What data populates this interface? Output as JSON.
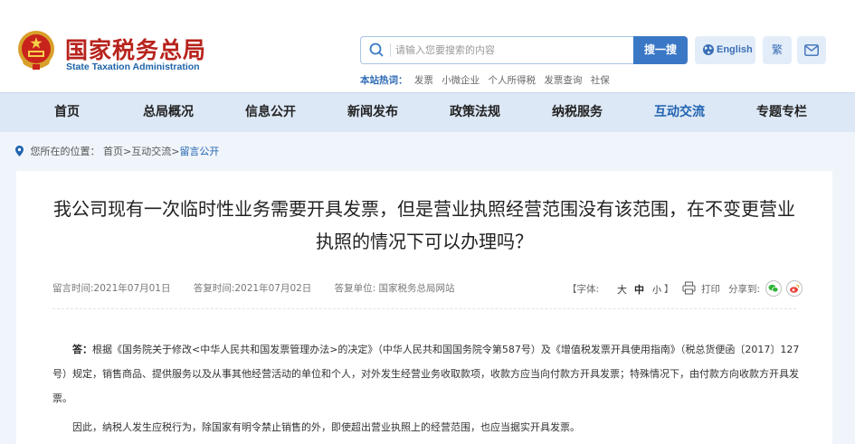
{
  "header": {
    "site_name_cn": "国家税务总局",
    "site_name_en": "State Taxation Administration",
    "search_placeholder": "请输入您要搜索的内容",
    "search_button": "搜一搜",
    "lang_english": "English",
    "lang_traditional": "繁",
    "hot_label": "本站热词：",
    "hot_words": [
      "发票",
      "小微企业",
      "个人所得税",
      "发票查询",
      "社保"
    ]
  },
  "nav": {
    "items": [
      "首页",
      "总局概况",
      "信息公开",
      "新闻发布",
      "政策法规",
      "纳税服务",
      "互动交流",
      "专题专栏"
    ],
    "active_index": 6
  },
  "breadcrumb": {
    "prefix": "您所在的位置：",
    "home": "首页",
    "sep1": ">",
    "level1": "互动交流",
    "sep2": ">",
    "current": "留言公开"
  },
  "article": {
    "title": "我公司现有一次临时性业务需要开具发票，但是营业执照经营范围没有该范围，在不变更营业执照的情况下可以办理吗？",
    "leave_time": "留言时间:2021年07月01日",
    "reply_time": "答复时间:2021年07月02日",
    "reply_unit": "答复单位:  国家税务总局网站",
    "font_label": "【字体:",
    "font_big": "大",
    "font_mid": "中",
    "font_small": "小",
    "font_close": "】",
    "print_label": "打印",
    "share_label": "分享到:",
    "answer_label": "答：",
    "answer_p1": "根据《国务院关于修改<中华人民共和国发票管理办法>的决定》（中华人民共和国国务院令第587号）及《增值税发票开具使用指南》（税总货便函〔2017〕127号）规定，销售商品、提供服务以及从事其他经营活动的单位和个人，对外发生经营业务收取款项，收款方应当向付款方开具发票；特殊情况下，由付款方向收款方开具发票。",
    "answer_p2": "因此，纳税人发生应税行为，除国家有明令禁止销售的外，即使超出营业执照上的经营范围，也应当据实开具发票。"
  },
  "colors": {
    "brand_red": "#b8231d",
    "brand_blue": "#1f62b1",
    "nav_bg": "#dce8f5",
    "page_bg": "#f0f5fb"
  }
}
